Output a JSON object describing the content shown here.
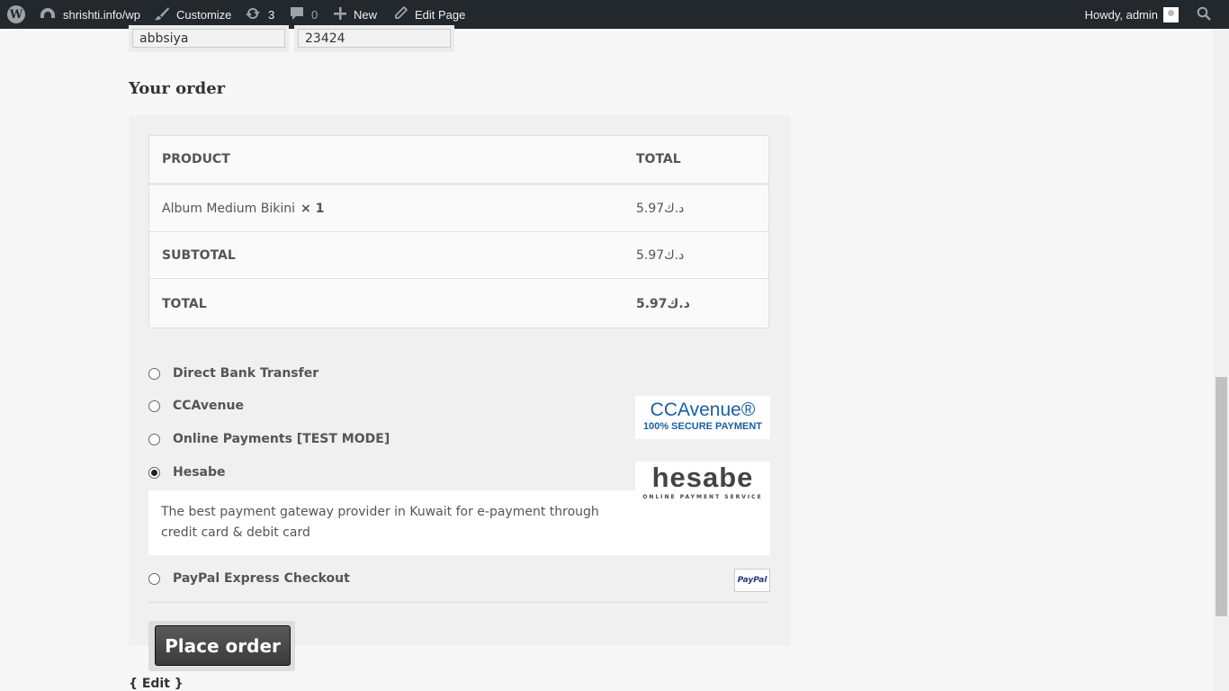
{
  "admin_bar": {
    "site_name": "shrishti.info/wp",
    "customize": "Customize",
    "updates_count": "3",
    "comments_count": "0",
    "new": "New",
    "edit_page": "Edit Page",
    "howdy": "Howdy, admin"
  },
  "address_fields": {
    "city": "abbsiya",
    "postcode": "23424"
  },
  "order": {
    "heading": "Your order",
    "headers": {
      "product": "PRODUCT",
      "total": "TOTAL"
    },
    "item": {
      "name": "Album Medium Bikini",
      "qty": "× 1",
      "total": "5.97د.ك"
    },
    "subtotal_label": "SUBTOTAL",
    "subtotal_value": "5.97د.ك",
    "total_label": "TOTAL",
    "total_value": "5.97د.ك"
  },
  "payment_methods": [
    {
      "label": "Direct Bank Transfer",
      "selected": false
    },
    {
      "label": "CCAvenue",
      "selected": false
    },
    {
      "label": "Online Payments [TEST MODE]",
      "selected": false
    },
    {
      "label": "Hesabe",
      "selected": true
    },
    {
      "label": "PayPal Express Checkout",
      "selected": false
    }
  ],
  "logos": {
    "ccavenue_top": "CCAvenue®",
    "ccavenue_bottom": "100% SECURE PAYMENT",
    "hesabe_top": "hesabe",
    "hesabe_bottom": "ONLINE PAYMENT SERVICE",
    "paypal": "PayPal"
  },
  "hesabe_description": "The best payment gateway provider in Kuwait for e-payment through credit card & debit card",
  "place_order": "Place order",
  "edit_link": "{ Edit }",
  "colors": {
    "admin_bar_bg": "#23282d",
    "button_bg": "#4a4a4a",
    "ccavenue_blue": "#1b5fa3"
  }
}
